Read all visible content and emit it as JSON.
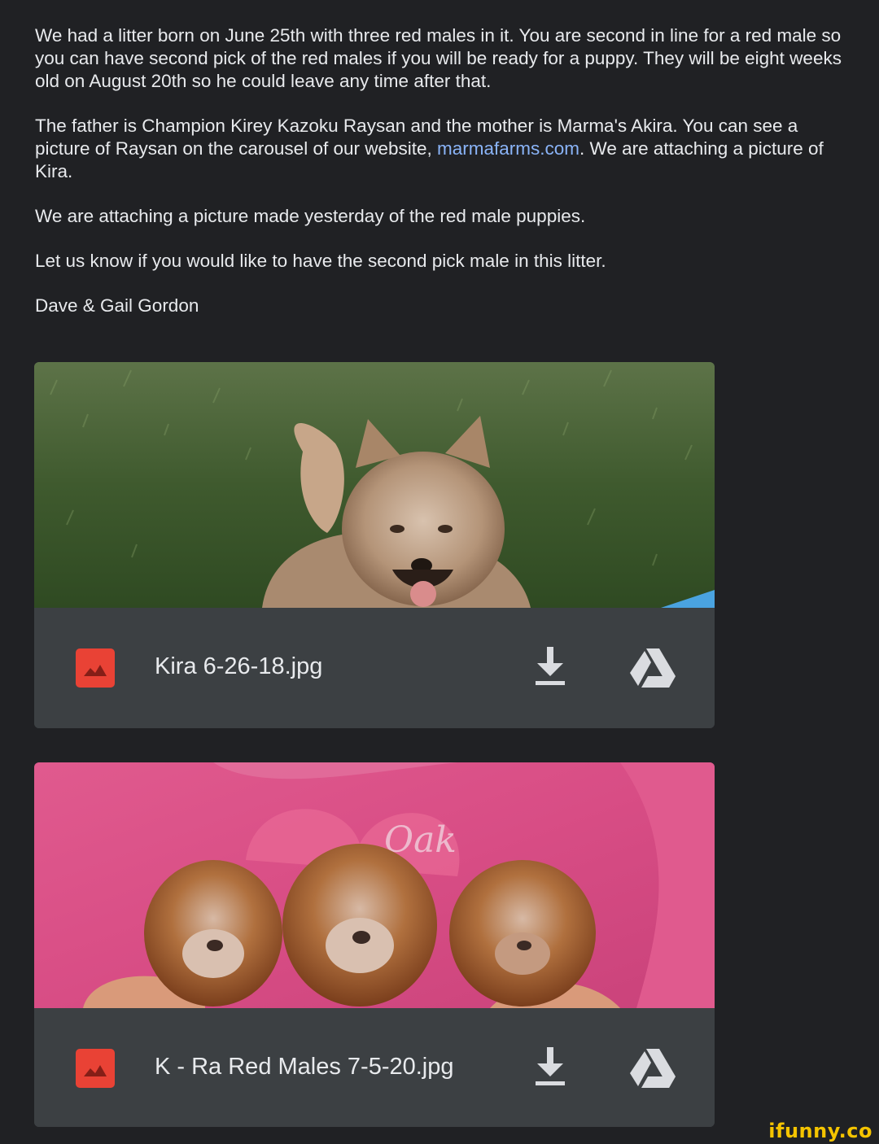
{
  "email": {
    "paragraphs": {
      "p1": "We had a litter born on June 25th with three red males in it.  You are second in line for a red male so you can have second pick of the red males if you will be ready for a puppy.  They will be eight weeks old on August 20th so he could leave any time after that.",
      "p2_before_link": "The father is Champion Kirey Kazoku Raysan and the mother is Marma's Akira.  You can see a picture of Raysan on the carousel of our website, ",
      "p2_link": "marmafarms.com",
      "p2_after_link": ".  We are attaching a picture of Kira.",
      "p3": "We are attaching a picture made yesterday of the red male puppies.",
      "p4": "Let us know if you would like to have the second pick male in this litter.",
      "signature": "Dave & Gail Gordon"
    }
  },
  "attachments": [
    {
      "file_name": "Kira 6-26-18.jpg",
      "file_type_icon": "image-file-icon",
      "download_icon": "download-icon",
      "drive_icon": "google-drive-icon",
      "preview_description": "shiba-inu-dog-on-grass"
    },
    {
      "file_name": "K - Ra Red Males 7-5-20.jpg",
      "preview_overlay_text": "Oak",
      "file_type_icon": "image-file-icon",
      "download_icon": "download-icon",
      "drive_icon": "google-drive-icon",
      "preview_description": "three-red-puppies-held-in-hands"
    }
  ],
  "watermark": {
    "text": "ifunny.co",
    "color": "#f5c400"
  },
  "colors": {
    "background": "#202124",
    "text": "#e8eaed",
    "link": "#8ab4f8",
    "attachment_bar": "#3c4043",
    "file_icon": "#e94235"
  }
}
